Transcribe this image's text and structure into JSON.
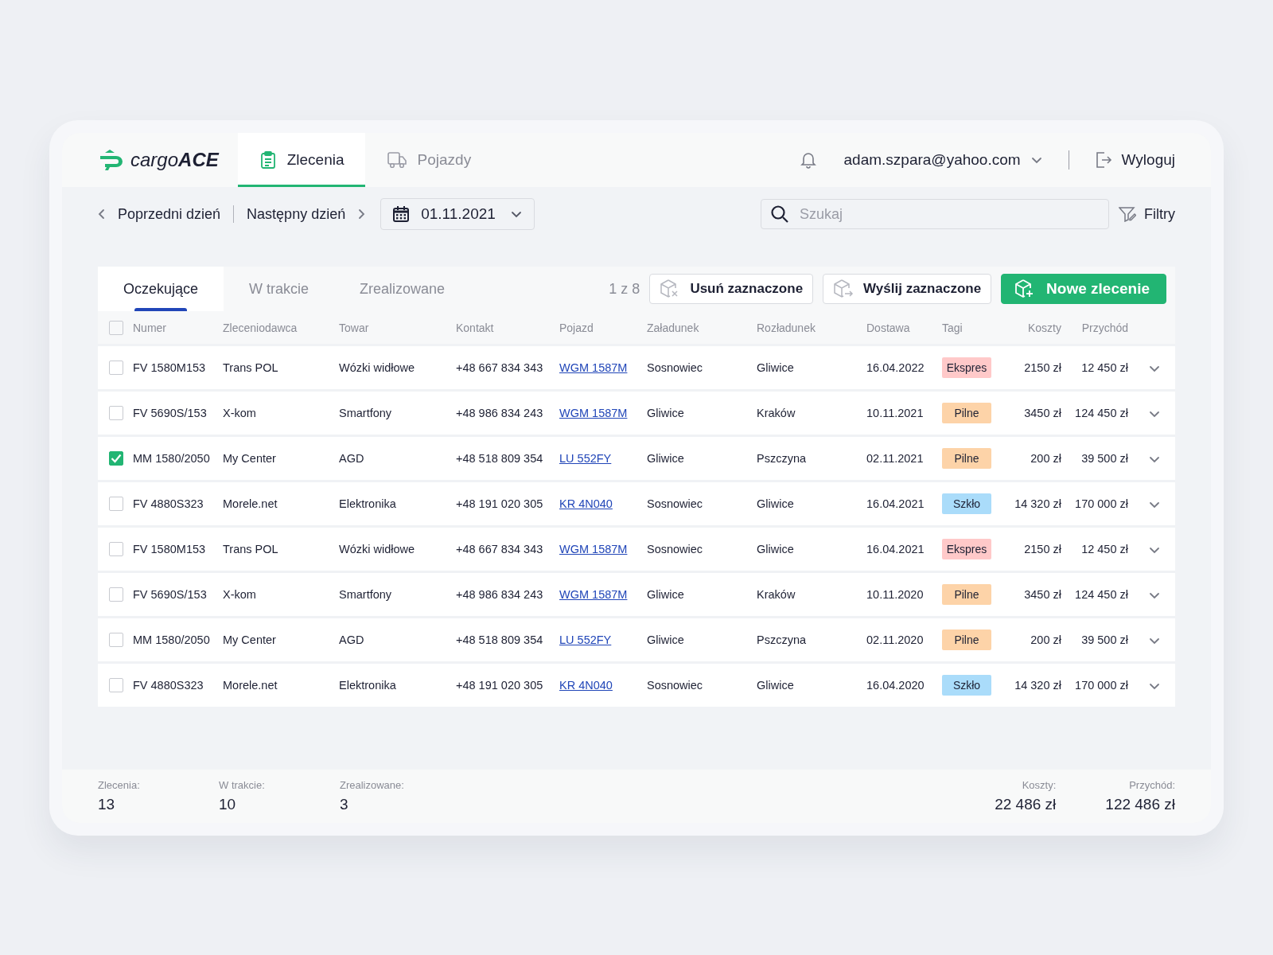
{
  "header": {
    "logo": "cargo**ACE**",
    "nav": [
      {
        "label": "Zlecenia",
        "kind": "orders",
        "selected": true
      },
      {
        "label": "Pojazdy",
        "kind": "vehicles",
        "selected": false
      }
    ],
    "user": "adam.szpara@yahoo.com",
    "logout": "Wyloguj"
  },
  "toolbar": {
    "prev": "Poprzedni dzień",
    "next": "Następny dzień",
    "date": "01.11.2021",
    "search": {
      "placeholder": "Szukaj"
    },
    "filters": "Filtry"
  },
  "orders": {
    "tabs": [
      {
        "label": "Oczekujące",
        "selected": true
      },
      {
        "label": "W trakcie",
        "selected": false
      },
      {
        "label": "Zrealizowane",
        "selected": false
      }
    ],
    "selection_count": "1 z 8",
    "actions": [
      {
        "label": "Usuń zaznaczone",
        "kind": "delete"
      },
      {
        "label": "Wyślij zaznaczone",
        "kind": "send"
      },
      {
        "label": "Nowe zlecenie",
        "kind": "create"
      }
    ],
    "all_checked": false,
    "columns": [
      "Numer",
      "Zleceniodawca",
      "Towar",
      "Kontakt",
      "Pojazd",
      "Załadunek",
      "Rozładunek",
      "Dostawa",
      "Tagi",
      "Koszty",
      "Przychód"
    ],
    "rows": [
      {
        "checked": false,
        "number": "FV 1580M153",
        "client": "Trans POL",
        "goods": "Wózki widłowe",
        "contact": "+48 667 834 343",
        "vehicle": "WGM 1587M",
        "loading": "Sosnowiec",
        "unloading": "Gliwice",
        "delivery": "16.04.2022",
        "tag": {
          "label": "Ekspres",
          "color": "#ffc9c9"
        },
        "costs": "2150 zł",
        "revenue": "12 450 zł"
      },
      {
        "checked": false,
        "number": "FV 5690S/153",
        "client": "X-kom",
        "goods": "Smartfony",
        "contact": "+48 986 834 243",
        "vehicle": "WGM 1587M",
        "loading": "Gliwice",
        "unloading": "Kraków",
        "delivery": "10.11.2021",
        "tag": {
          "label": "Pilne",
          "color": "#fdd3a8"
        },
        "costs": "3450 zł",
        "revenue": "124 450 zł"
      },
      {
        "checked": true,
        "number": "MM 1580/2050",
        "client": "My Center",
        "goods": "AGD",
        "contact": "+48 518 809 354",
        "vehicle": "LU 552FY",
        "loading": "Gliwice",
        "unloading": "Pszczyna",
        "delivery": "02.11.2021",
        "tag": {
          "label": "Pilne",
          "color": "#fdd3a8"
        },
        "costs": "200 zł",
        "revenue": "39 500 zł"
      },
      {
        "checked": false,
        "number": "FV 4880S323",
        "client": "Morele.net",
        "goods": "Elektronika",
        "contact": "+48 191 020 305",
        "vehicle": "KR 4N040",
        "loading": "Sosnowiec",
        "unloading": "Gliwice",
        "delivery": "16.04.2021",
        "tag": {
          "label": "Szkło",
          "color": "#aadcfa"
        },
        "costs": "14 320 zł",
        "revenue": "170 000 zł"
      },
      {
        "checked": false,
        "number": "FV 1580M153",
        "client": "Trans POL",
        "goods": "Wózki widłowe",
        "contact": "+48 667 834 343",
        "vehicle": "WGM 1587M",
        "loading": "Sosnowiec",
        "unloading": "Gliwice",
        "delivery": "16.04.2021",
        "tag": {
          "label": "Ekspres",
          "color": "#ffc9c9"
        },
        "costs": "2150 zł",
        "revenue": "12 450 zł"
      },
      {
        "checked": false,
        "number": "FV 5690S/153",
        "client": "X-kom",
        "goods": "Smartfony",
        "contact": "+48 986 834 243",
        "vehicle": "WGM 1587M",
        "loading": "Gliwice",
        "unloading": "Kraków",
        "delivery": "10.11.2020",
        "tag": {
          "label": "Pilne",
          "color": "#fdd3a8"
        },
        "costs": "3450 zł",
        "revenue": "124 450 zł"
      },
      {
        "checked": false,
        "number": "MM 1580/2050",
        "client": "My Center",
        "goods": "AGD",
        "contact": "+48 518 809 354",
        "vehicle": "LU 552FY",
        "loading": "Gliwice",
        "unloading": "Pszczyna",
        "delivery": "02.11.2020",
        "tag": {
          "label": "Pilne",
          "color": "#fdd3a8"
        },
        "costs": "200 zł",
        "revenue": "39 500 zł"
      },
      {
        "checked": false,
        "number": "FV 4880S323",
        "client": "Morele.net",
        "goods": "Elektronika",
        "contact": "+48 191 020 305",
        "vehicle": "KR 4N040",
        "loading": "Sosnowiec",
        "unloading": "Gliwice",
        "delivery": "16.04.2020",
        "tag": {
          "label": "Szkło",
          "color": "#aadcfa"
        },
        "costs": "14 320 zł",
        "revenue": "170 000 zł"
      }
    ]
  },
  "summary": {
    "counts": [
      {
        "label": "Zlecenia:",
        "value": "13"
      },
      {
        "label": "W trakcie:",
        "value": "10"
      },
      {
        "label": "Zrealizowane:",
        "value": "3"
      }
    ],
    "totals": [
      {
        "label": "Koszty:",
        "value": "22 486 zł"
      },
      {
        "label": "Przychód:",
        "value": "122 486 zł"
      }
    ]
  }
}
